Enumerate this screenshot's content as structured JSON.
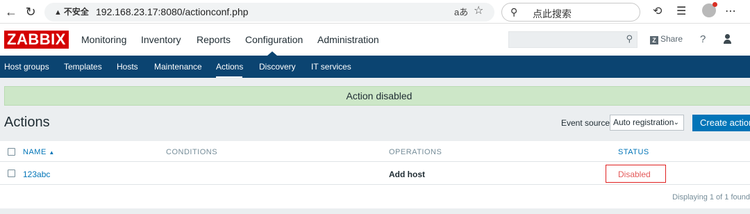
{
  "browser": {
    "back_icon": "back-arrow-icon",
    "reload_icon": "reload-icon",
    "security_label": "不安全",
    "url": "192.168.23.17:8080/actionconf.php",
    "search_placeholder": "点此搜索",
    "read_aloud": "aあ"
  },
  "zabbix": {
    "logo": "ZABBIX",
    "main_nav": [
      "Monitoring",
      "Inventory",
      "Reports",
      "Configuration",
      "Administration"
    ],
    "active_main": "Configuration",
    "share_label": "Share",
    "help_label": "?",
    "sub_nav": [
      "Host groups",
      "Templates",
      "Hosts",
      "Maintenance",
      "Actions",
      "Discovery",
      "IT services"
    ],
    "active_sub": "Actions"
  },
  "message": "Action disabled",
  "page": {
    "title": "Actions",
    "event_source_label": "Event source",
    "event_source_value": "Auto registration",
    "create_button": "Create action"
  },
  "table": {
    "columns": {
      "name": "NAME",
      "conditions": "CONDITIONS",
      "operations": "OPERATIONS",
      "status": "STATUS"
    },
    "sort_indicator": "▲",
    "rows": [
      {
        "name": "123abc",
        "conditions": "",
        "operations": "Add host",
        "status": "Disabled"
      }
    ],
    "footer": "Displaying 1 of 1 found"
  },
  "colors": {
    "brand_red": "#d40000",
    "nav_blue": "#0b4471",
    "link_blue": "#0275b8",
    "success_bg": "#cde7c8",
    "disabled_red": "#e45959"
  }
}
